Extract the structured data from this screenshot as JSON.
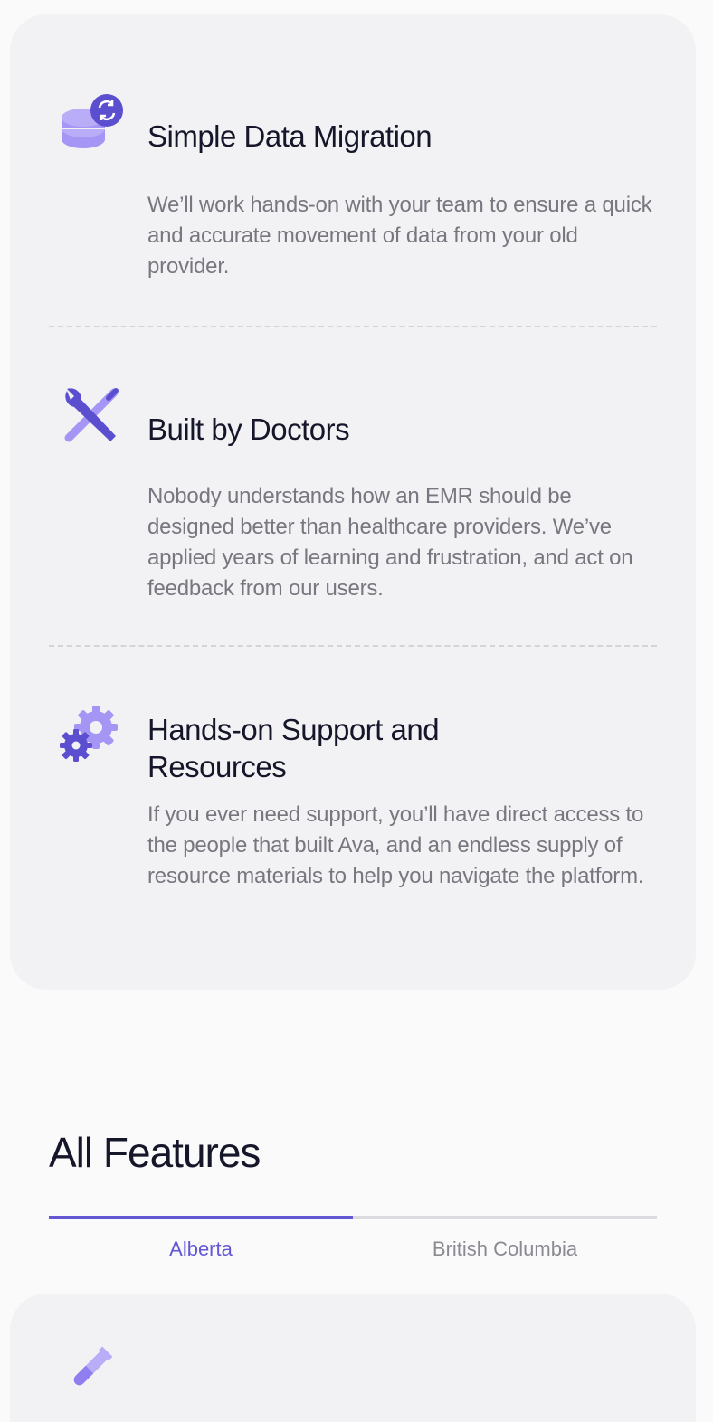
{
  "benefits": [
    {
      "icon": "database-sync-icon",
      "title": "Simple Data Migration",
      "description": "We’ll work hands-on with your team to ensure a quick and accurate movement of data from your old provider."
    },
    {
      "icon": "wrench-screwdriver-icon",
      "title": "Built by Doctors",
      "description": "Nobody understands how an EMR should be designed better than healthcare providers. We’ve applied years of learning and frustration, and act on feedback from our users."
    },
    {
      "icon": "gears-icon",
      "title": "Hands-on Support and Resources",
      "description": "If you ever need support, you’ll have direct access to the people that built Ava, and an endless supply of resource materials to help you navigate the platform."
    }
  ],
  "features": {
    "title": "All Features",
    "tabs": [
      {
        "label": "Alberta",
        "active": true
      },
      {
        "label": "British Columbia",
        "active": false
      }
    ],
    "first_card_icon": "test-tube-icon"
  },
  "colors": {
    "accent": "#6357d3",
    "accent_light": "#a596f5",
    "card_bg": "#f2f2f5",
    "page_bg": "#fafafb",
    "text_dark": "#16162a",
    "text_muted": "#77777f"
  }
}
